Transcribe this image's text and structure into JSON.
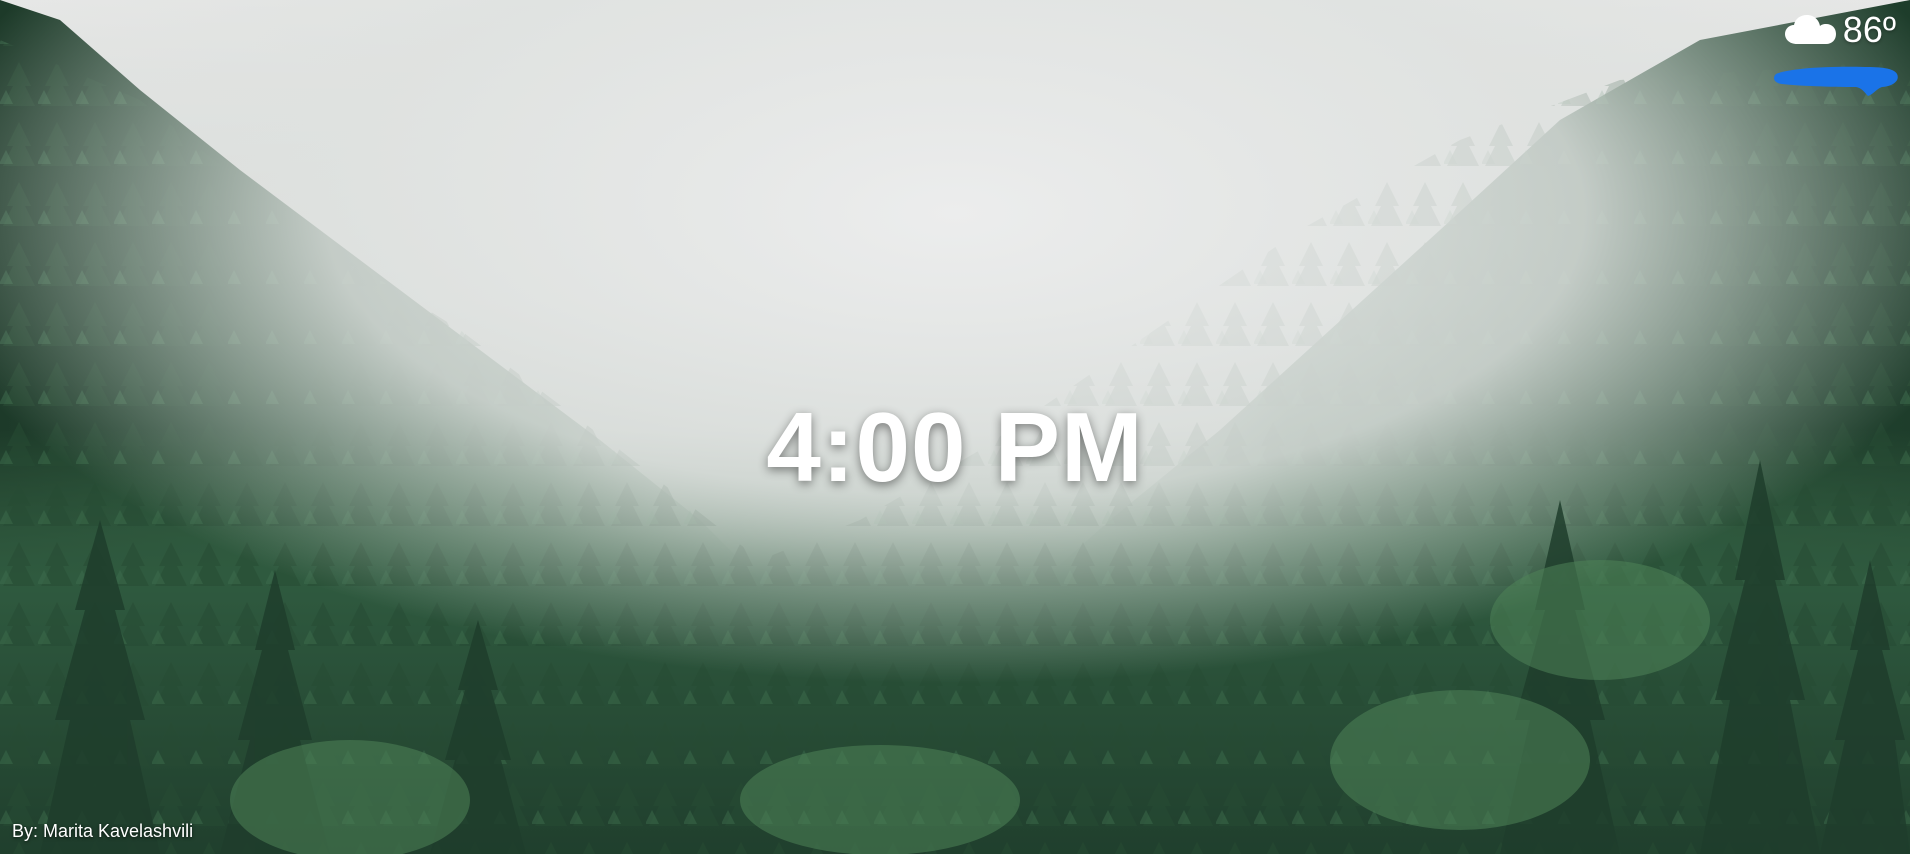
{
  "weather": {
    "icon": "cloud-icon",
    "temperature": "86º"
  },
  "clock": {
    "time": "4:00 PM"
  },
  "photo_credit": {
    "text": "By: Marita Kavelashvili"
  },
  "colors": {
    "fog": "#dcdedd",
    "forest_dark": "#1f3b2b",
    "forest_mid": "#2f5a3f",
    "forest_light": "#4a7a55",
    "redaction_blue": "#1a73e8",
    "text": "#ffffff"
  }
}
